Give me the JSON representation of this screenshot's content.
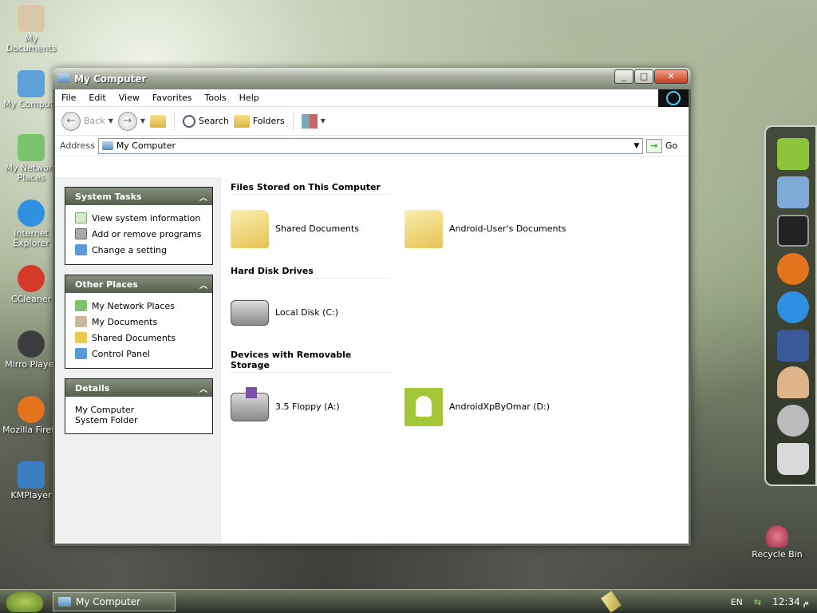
{
  "desktop": {
    "icons": [
      {
        "label": "My Documents",
        "color": "#d9c7a8"
      },
      {
        "label": "My Compute",
        "color": "#5ea0d8"
      },
      {
        "label": "My Network Places",
        "color": "#7cc46b"
      },
      {
        "label": "Internet Explorer",
        "color": "#2f8fe0"
      },
      {
        "label": "CCleaner",
        "color": "#d83a2a"
      },
      {
        "label": "Mirro Player",
        "color": "#3d3d3d"
      },
      {
        "label": "Mozilla Firefo",
        "color": "#e3731c"
      },
      {
        "label": "KMPlayer",
        "color": "#3b7ec2"
      }
    ],
    "recycle_bin": {
      "label": "Recycle Bin"
    }
  },
  "window": {
    "title": "My Computer",
    "menu": [
      "File",
      "Edit",
      "View",
      "Favorites",
      "Tools",
      "Help"
    ],
    "toolbar": {
      "back_label": "Back",
      "search_label": "Search",
      "folders_label": "Folders"
    },
    "address": {
      "label": "Address",
      "value": "My Computer",
      "go_label": "Go"
    }
  },
  "sidebar": {
    "system_tasks": {
      "title": "System Tasks",
      "items": [
        {
          "label": "View system information",
          "icon": "info-icon"
        },
        {
          "label": "Add or remove programs",
          "icon": "programs-icon"
        },
        {
          "label": "Change a setting",
          "icon": "settings-icon"
        }
      ]
    },
    "other_places": {
      "title": "Other Places",
      "items": [
        {
          "label": "My Network Places",
          "icon": "network-icon"
        },
        {
          "label": "My Documents",
          "icon": "documents-icon"
        },
        {
          "label": "Shared Documents",
          "icon": "folder-icon"
        },
        {
          "label": "Control Panel",
          "icon": "control-panel-icon"
        }
      ]
    },
    "details": {
      "title": "Details",
      "name": "My Computer",
      "type": "System Folder"
    }
  },
  "main": {
    "groups": [
      {
        "title": "Files Stored on This Computer",
        "items": [
          {
            "label": "Shared Documents",
            "icon": "folder-icon"
          },
          {
            "label": "Android-User's Documents",
            "icon": "folder-icon"
          }
        ]
      },
      {
        "title": "Hard Disk Drives",
        "items": [
          {
            "label": "Local Disk (C:)",
            "icon": "hard-disk-icon"
          }
        ]
      },
      {
        "title": "Devices with Removable Storage",
        "items": [
          {
            "label": "3.5 Floppy (A:)",
            "icon": "floppy-icon"
          },
          {
            "label": "AndroidXpByOmar (D:)",
            "icon": "android-drive-icon"
          }
        ]
      }
    ]
  },
  "dock": {
    "items": [
      {
        "name": "android-icon",
        "color": "#8cc43c"
      },
      {
        "name": "computer-icon",
        "color": "#7fa9d6"
      },
      {
        "name": "tablet-icon",
        "color": "#222222"
      },
      {
        "name": "firefox-icon",
        "color": "#e3731c"
      },
      {
        "name": "internet-explorer-icon",
        "color": "#2f8fe0"
      },
      {
        "name": "facebook-icon",
        "color": "#3b5998"
      },
      {
        "name": "support-agent-icon",
        "color": "#e0b48a"
      },
      {
        "name": "settings-gear-icon",
        "color": "#bbbbbb"
      },
      {
        "name": "trash-icon",
        "color": "#d9d9d9"
      }
    ]
  },
  "taskbar": {
    "task_label": "My Computer",
    "language": "EN",
    "time": "12:34",
    "period": " م"
  }
}
